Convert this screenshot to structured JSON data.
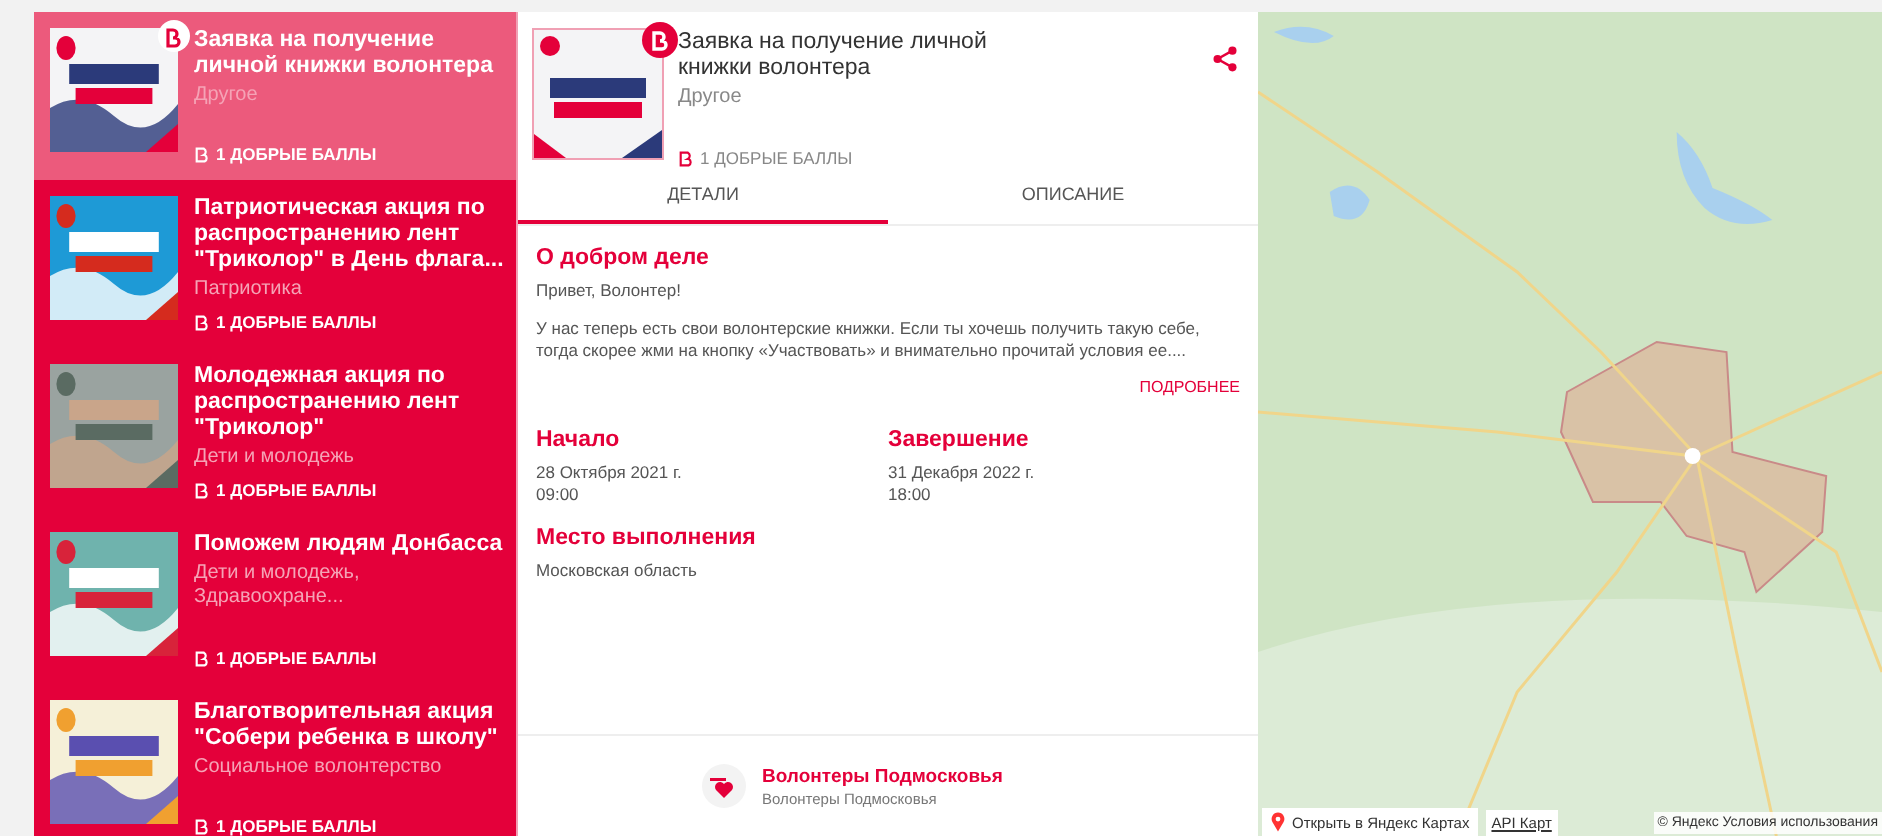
{
  "events": [
    {
      "title": "Заявка на получение личной книжки волонтера",
      "category": "Другое",
      "points": "1 ДОБРЫЕ БАЛЛЫ",
      "selected": true,
      "badge": true
    },
    {
      "title": "Патриотическая акция по распространению лент \"Триколор\" в День флага...",
      "category": "Патриотика",
      "points": "1 ДОБРЫЕ БАЛЛЫ",
      "selected": false,
      "badge": false
    },
    {
      "title": "Молодежная акция по распространению лент \"Триколор\"",
      "category": "Дети и молодежь",
      "points": "1 ДОБРЫЕ БАЛЛЫ",
      "selected": false,
      "badge": false
    },
    {
      "title": "Поможем людям Донбасса",
      "category": "Дети и молодежь, Здравоохране...",
      "points": "1 ДОБРЫЕ БАЛЛЫ",
      "selected": false,
      "badge": false
    },
    {
      "title": "Благотворительная акция \"Собери ребенка в школу\"",
      "category": "Социальное волонтерство",
      "points": "1 ДОБРЫЕ БАЛЛЫ",
      "selected": false,
      "badge": false
    }
  ],
  "detail": {
    "title": "Заявка на получение личной книжки волонтера",
    "category": "Другое",
    "points": "1 ДОБРЫЕ БАЛЛЫ",
    "tabs": [
      {
        "label": "ДЕТАЛИ",
        "selected": true
      },
      {
        "label": "ОПИСАНИЕ",
        "selected": false
      }
    ],
    "about_heading": "О добром деле",
    "greeting": "Привет, Волонтер!",
    "about_text": "У нас теперь есть свои волонтерские книжки. Если ты хочешь получить такую себе, тогда скорее жми на кнопку «Участвовать» и внимательно прочитай условия ее....",
    "more_link": "ПОДРОБНЕЕ",
    "start": {
      "heading": "Начало",
      "date": "28 Октября 2021 г.",
      "time": "09:00"
    },
    "end": {
      "heading": "Завершение",
      "date": "31 Декабря 2022 г.",
      "time": "18:00"
    },
    "place": {
      "heading": "Место выполнения",
      "value": "Московская область"
    },
    "organizer": {
      "name": "Волонтеры Подмосковья",
      "subtitle": "Волонтеры Подмосковья"
    }
  },
  "map": {
    "open_link": "Открыть в Яндекс Картах",
    "api_link": "API Карт",
    "copyright": "© Яндекс Условия использования"
  }
}
